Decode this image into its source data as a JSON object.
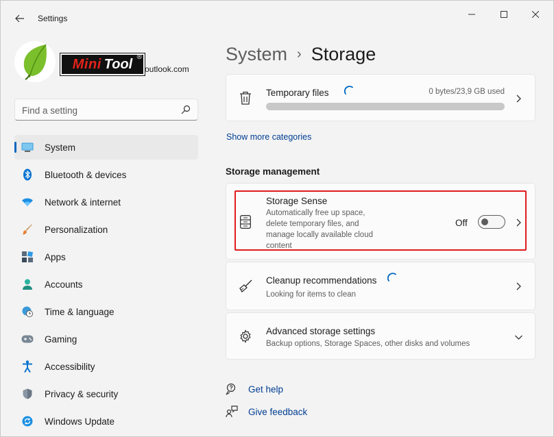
{
  "app": {
    "title": "Settings"
  },
  "account": {
    "email": "outlook.com",
    "brand_mini": "Mini",
    "brand_tool": "Tool",
    "brand_reg": "®"
  },
  "search": {
    "placeholder": "Find a setting"
  },
  "nav": {
    "items": [
      {
        "label": "System",
        "icon": "monitor-icon",
        "active": true
      },
      {
        "label": "Bluetooth & devices",
        "icon": "bluetooth-icon"
      },
      {
        "label": "Network & internet",
        "icon": "wifi-icon"
      },
      {
        "label": "Personalization",
        "icon": "paintbrush-icon"
      },
      {
        "label": "Apps",
        "icon": "apps-icon"
      },
      {
        "label": "Accounts",
        "icon": "person-icon"
      },
      {
        "label": "Time & language",
        "icon": "globe-clock-icon"
      },
      {
        "label": "Gaming",
        "icon": "gamepad-icon"
      },
      {
        "label": "Accessibility",
        "icon": "accessibility-icon"
      },
      {
        "label": "Privacy & security",
        "icon": "shield-icon"
      },
      {
        "label": "Windows Update",
        "icon": "update-icon"
      }
    ]
  },
  "breadcrumb": {
    "parent": "System",
    "separator": "›",
    "current": "Storage"
  },
  "temp_files": {
    "title": "Temporary files",
    "used": "0 bytes/23,9 GB used",
    "progress": 0.0
  },
  "show_more": "Show more categories",
  "storage_management": {
    "title": "Storage management",
    "sense": {
      "title": "Storage Sense",
      "desc_lines": [
        "Automatically free up space,",
        "delete temporary files, and",
        "manage locally available cloud",
        "content"
      ],
      "toggle_label": "Off",
      "toggle_on": false
    },
    "cleanup": {
      "title": "Cleanup recommendations",
      "sub": "Looking for items to clean"
    },
    "advanced": {
      "title": "Advanced storage settings",
      "sub": "Backup options, Storage Spaces, other disks and volumes"
    }
  },
  "help": {
    "get_help": "Get help",
    "give_feedback": "Give feedback"
  },
  "colors": {
    "accent": "#0067c0",
    "link": "#003e92",
    "highlight": "#e01b1b"
  }
}
